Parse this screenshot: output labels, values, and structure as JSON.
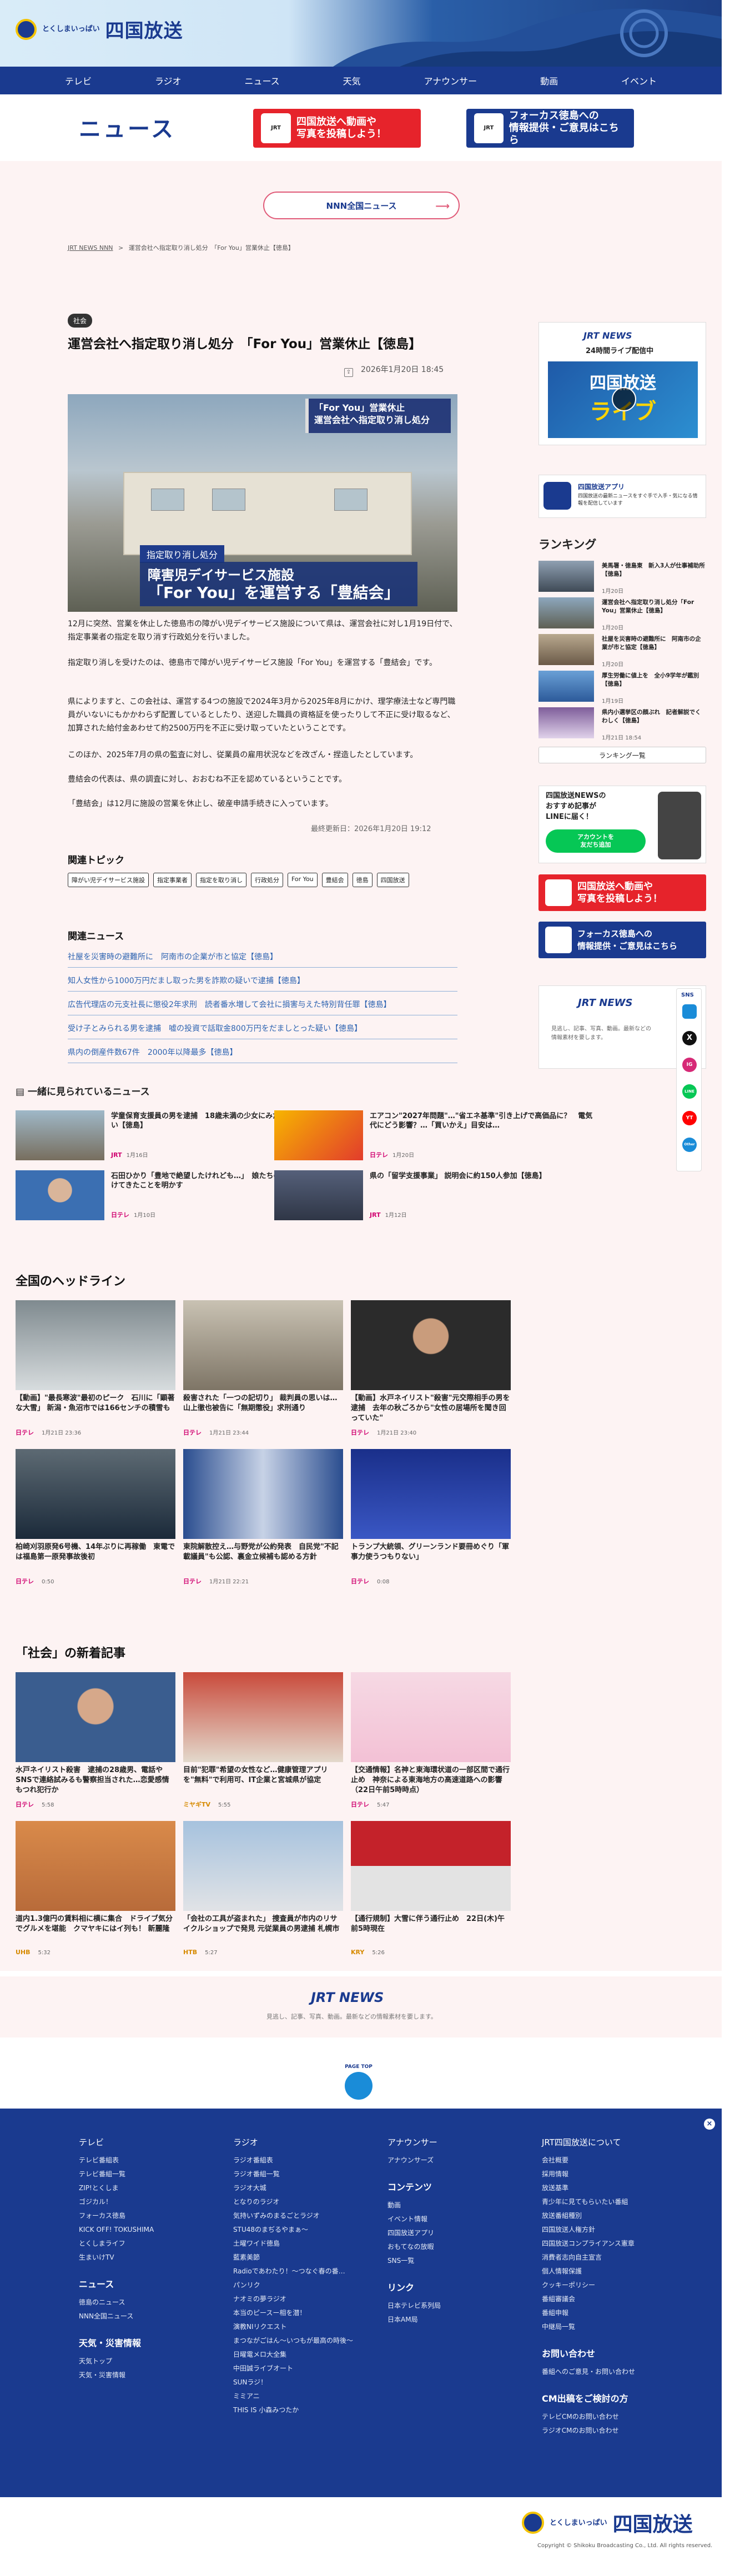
{
  "header": {
    "logo_small": "とくしまいっぱい",
    "logo_main": "四国放送",
    "nav": [
      "テレビ",
      "ラジオ",
      "ニュース",
      "天気",
      "アナウンサー",
      "動画",
      "イベント"
    ]
  },
  "page_title": "ニュース",
  "banners": {
    "post": "四国放送へ動画や\n写真を投稿しよう！",
    "focus": "フォーカス徳島への\n情報提供・ご意見はこちら"
  },
  "nnn_button": "NNN全国ニュース",
  "breadcrumb": {
    "home": "JRT NEWS NNN",
    "sep": ">",
    "current": "運営会社へ指定取り消し処分　「For You」営業休止【徳島】"
  },
  "article": {
    "category": "社会",
    "title": "運営会社へ指定取り消し処分　「For You」営業休止【徳島】",
    "date": "2026年1月20日 18:45",
    "photo_caption_top": "「For You」営業休止\n運営会社へ指定取り消し処分",
    "photo_caption_tag": "指定取り消し処分",
    "photo_caption_main1": "障害児デイサービス施設",
    "photo_caption_main2": "「For You」を運営する「豊結会」",
    "p1": "12月に突然、営業を休止した徳島市の障がい児デイサービス施設について県は、運営会社に対し1月19日付で、指定事業者の指定を取り消す行政処分を行いました。",
    "p2": "指定取り消しを受けたのは、徳島市で障がい児デイサービス施設「For You」を運営する「豊結会」です。",
    "p3": "県によりますと、この会社は、運営する4つの施設で2024年3月から2025年8月にかけ、理学療法士など専門職員がいないにもかかわらず配置しているとしたり、送迎した職員の資格証を使ったりして不正に受け取るなど、加算された給付金あわせて約2500万円を不正に受け取っていたということです。",
    "p4": "このほか、2025年7月の県の監査に対し、従業員の雇用状況などを改ざん・捏造したとしています。",
    "p5": "豊結会の代表は、県の調査に対し、おおむね不正を認めているということです。",
    "p6": "「豊結会」は12月に施設の営業を休止し、破産申請手続きに入っています。",
    "updated": "最終更新日：2026年1月20日 19:12"
  },
  "topics": {
    "heading": "関連トピック",
    "tags": [
      "障がい児デイサービス施設",
      "指定事業者",
      "指定を取り消し",
      "行政処分",
      "For You",
      "豊結会",
      "徳島",
      "四国放送"
    ]
  },
  "related": {
    "heading": "関連ニュース",
    "items": [
      "社屋を災害時の避難所に　阿南市の企業が市と協定【徳島】",
      "知人女性から1000万円だまし取った男を詐欺の疑いで逮捕【徳島】",
      "広告代理店の元支社長に懲役2年求刑　読者番水増して会社に損害与えた特別背任罪【徳島】",
      "受け子とみられる男を逮捕　嘘の投資で話取金800万円をだましとった疑い【徳島】",
      "県内の倒産件数67件　2000年以降最多【徳島】"
    ]
  },
  "popular": {
    "heading": "一緒に見られているニュース",
    "items": [
      {
        "title": "学童保育支援員の男を逮捕　18歳未満の少女にみだらな行為をした疑い【徳島】",
        "source": "JRT",
        "date": "1月16日"
      },
      {
        "title": "エアコン\"2027年問題\"…\"省エネ基準\"引き上げで高価品に？　電気代にどう影響？…「買いかえ」目安は…",
        "source": "日テレ",
        "date": "1月20日"
      },
      {
        "title": "石田ひかり「豊地で絶望したけれども…」　娘たちのために16年間続けてきたことを明かす",
        "source": "日テレ",
        "date": "1月10日"
      },
      {
        "title": "県の「留学支援事業」 説明会に約150人参加【徳島】",
        "source": "JRT",
        "date": "1月12日"
      }
    ]
  },
  "headlines": {
    "heading": "全国のヘッドライン",
    "items": [
      {
        "title": "【動画】\"最長寒波\"最初のピーク　石川に「顕著な大雪」 新潟・魚沼市では166センチの積雪も",
        "source": "日テレ",
        "time": "1月21日 23:36"
      },
      {
        "title": "殺害された「一つの記切り」 裁判員の思いは…　山上徹也被告に「無期懲役」求刑通り",
        "source": "日テレ",
        "time": "1月21日 23:44"
      },
      {
        "title": "【動画】水戸ネイリスト\"殺害\"元交際相手の男を逮捕　去年の秋ごろから\"女性の居場所を聞き回っていた\"",
        "source": "日テレ",
        "time": "1月21日 23:40"
      },
      {
        "title": "柏崎刈羽原発6号機、14年ぶりに再稼働　東電では福島第一原発事故後初",
        "source": "日テレ",
        "time": "0:50"
      },
      {
        "title": "東院解散控え…与野党が公約発表　自民党\"不記載議員\"も公認、裏金立候補も認める方針",
        "source": "日テレ",
        "time": "1月21日 22:21"
      },
      {
        "title": "トランプ大統領、グリーンランド要冊めぐり「軍事力使うつもりない」",
        "source": "日テレ",
        "time": "0:08"
      }
    ]
  },
  "social": {
    "heading": "「社会」の新着記事",
    "items": [
      {
        "title": "水戸ネイリスト殺害　逮捕の28歳男、電話やSNSで連絡試みるも警察担当された…恋愛感情もつれ犯行か",
        "source": "日テレ",
        "time": "5:58"
      },
      {
        "title": "目前\"犯罪\"希望の女性など…健康管理アプリを\"無料\"で利用可、IT企業と宮城県が協定",
        "source": "ミヤギTV",
        "time": "5:55"
      },
      {
        "title": "【交通情報】名神と東海環状道の一部区間で通行止め　神奈による東海地方の高速道路への影響（22日午前5時時点）",
        "source": "日テレ",
        "time": "5:47"
      },
      {
        "title": "道内1.3億円の賃料相に横に集合　ドライブ気分でグルメを堪能　クマヤキにはイ列も！ 新麗隆",
        "source": "UHB",
        "time": "5:32"
      },
      {
        "title": "「会社の工具が盗まれた」 捜査員が市内のリサイクルショップで発見 元従業員の男逮捕 札幌市",
        "source": "HTB",
        "time": "5:27"
      },
      {
        "title": "【通行規制】大雪に伴う通行止め　22日(木)午前5時現在",
        "source": "KRY",
        "time": "5:26"
      }
    ]
  },
  "sidebar": {
    "jrt_news": "JRT NEWS",
    "live_sub": "24時間ライブ配信中",
    "live_a": "四国放送",
    "live_b": "ライブ",
    "app_title": "四国放送アプリ",
    "app_desc": "四国放送の最新ニュースをすぐ手で入手・気になる情報を配信しています",
    "ranking_heading": "ランキング",
    "ranking": [
      {
        "title": "美馬署・徳島東　新入3人が仕事補助所【徳島】",
        "date": "1月20日"
      },
      {
        "title": "運営会社へ指定取り消し処分「For You」営業休止【徳島】",
        "date": "1月20日"
      },
      {
        "title": "社屋を災害時の避難所に　阿南市の企業が市と協定【徳島】",
        "date": "1月20日"
      },
      {
        "title": "厚生労働に値上を　全小9学年が鑑別【徳島】",
        "date": "1月19日"
      },
      {
        "title": "県内小選挙区の顔ぶれ　記者解説でくわしく【徳島】",
        "date": "1月21日 18:54"
      }
    ],
    "ranking_more": "ランキング一覧",
    "line_title": "四国放送NEWSの\nおすすめ記事が\nLINEに届く！",
    "line_btn": "アカウントを\n友だち追加",
    "post_banner": "四国放送へ動画や\n写真を投稿しよう！",
    "focus_banner": "フォーカス徳島への\n情報提供・ご意見はこちら",
    "jrt_desc": "見逃し、記事、写真、動画。最新などの情報素材を要します。",
    "sns_label": "SNS",
    "sns": [
      "X",
      "IG",
      "LINE",
      "YT",
      "Other"
    ]
  },
  "jrt_footer": {
    "logo": "JRT NEWS",
    "desc": "見逃し、記事、写真、動画。最新などの情報素材を要します。"
  },
  "pagetop": "PAGE TOP",
  "footer": {
    "col1": {
      "h": "テレビ",
      "items": [
        "テレビ番組表",
        "テレビ番組一覧",
        "ZIP!とくしま",
        "ゴジカル！",
        "フォーカス徳島",
        "KICK OFF! TOKUSHIMA",
        "とくしまライフ",
        "生まいけTV"
      ],
      "h2": "ニュース",
      "items2": [
        "徳島のニュース",
        "NNN全国ニュース"
      ],
      "h3": "天気・災害情報",
      "items3": [
        "天気トップ",
        "天気・災害情報"
      ]
    },
    "col2": {
      "h": "ラジオ",
      "items": [
        "ラジオ番組表",
        "ラジオ番組一覧",
        "ラジオ大城",
        "となりのラジオ",
        "気持いずみのまるごとラジオ",
        "STU48のまぢるやまぁ～",
        "土曜ワイド徳島",
        "藍素美節",
        "Radioであわたり！～つなぐ春の番…",
        "パンリク",
        "ナオミの夢ラジオ",
        "本当のピースー相を潜！",
        "演教NIリクエスト",
        "まつながごはん～いつもが最高の時後～",
        "日曜電メロ大全集",
        "中田誠ライブオート",
        "SUNラジ！",
        "ミミアニ",
        "THIS IS 小森みつたか"
      ]
    },
    "col3": {
      "h": "アナウンサー",
      "items": [
        "アナウンサーズ"
      ],
      "h2": "コンテンツ",
      "items2": [
        "動画",
        "イベント情報",
        "四国放送アプリ",
        "おもてなの放暇",
        "SNS一覧"
      ],
      "h3": "リンク",
      "items3": [
        "日本テレビ系列局",
        "日本AM局"
      ]
    },
    "col4": {
      "h": "JRT四国放送について",
      "items": [
        "会社概要",
        "採用情報",
        "放送基準",
        "青少年に見てもらいたい番組",
        "放送番組種別",
        "四国放送人権方針",
        "四国放送コンプライアンス憲章",
        "消費者志向自主宣言",
        "個人情報保護",
        "クッキーポリシー",
        "番組審議会",
        "番組申報",
        "中継局一覧"
      ],
      "h2": "お問い合わせ",
      "items2": [
        "番組へのご意見・お問い合わせ"
      ],
      "h3": "CM出稿をご検討の方",
      "items3": [
        "テレビCMのお問い合わせ",
        "ラジオCMのお問い合わせ"
      ]
    }
  },
  "copyright": "Copyright © Shikoku Broadcasting Co., Ltd. All rights reserved.",
  "colors": {
    "brand": "#1a3a8f",
    "accent": "#e6232b",
    "pink_bg": "#fdf3f3",
    "link": "#2d63b1"
  }
}
